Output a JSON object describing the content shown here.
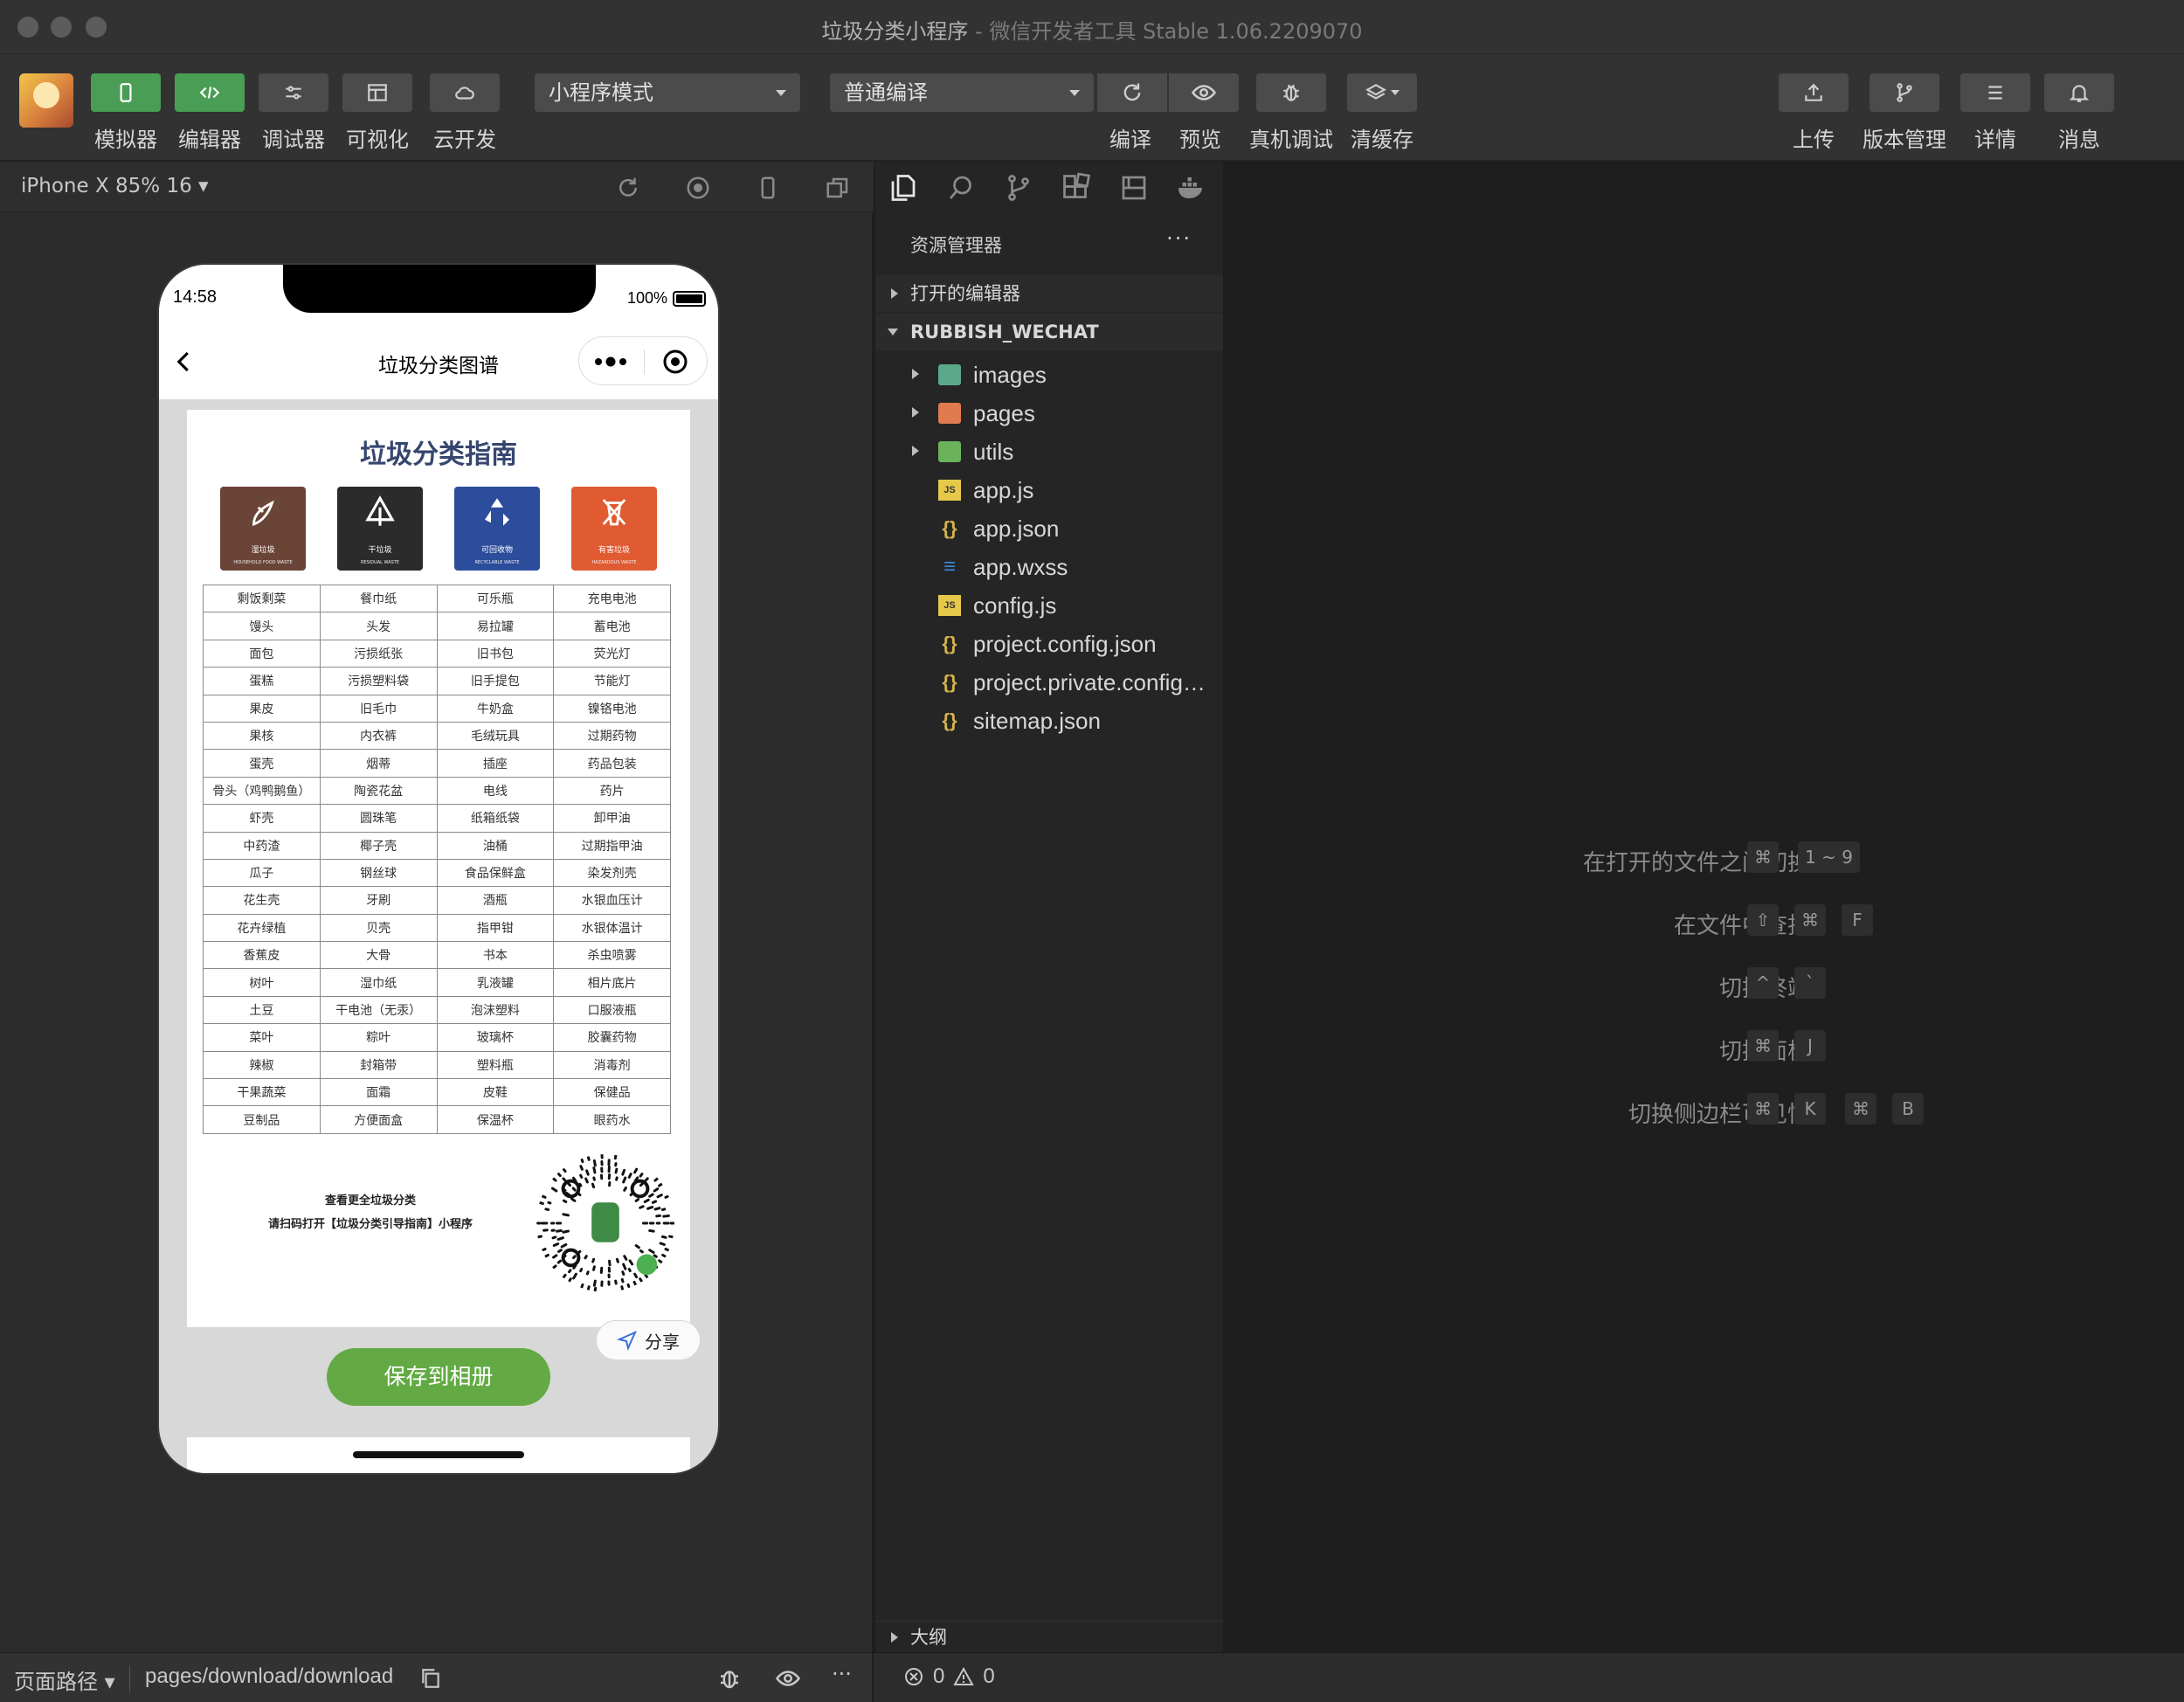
{
  "window": {
    "title_main": "垃圾分类小程序",
    "title_sep": " - ",
    "title_app": "微信开发者工具 Stable 1.06.2209070"
  },
  "toolbar": {
    "left_buttons": [
      {
        "label": "模拟器",
        "icon": "phone-icon",
        "active": true
      },
      {
        "label": "编辑器",
        "icon": "code-icon",
        "active": true
      },
      {
        "label": "调试器",
        "icon": "debug-sliders-icon",
        "active": false
      },
      {
        "label": "可视化",
        "icon": "layout-icon",
        "active": false
      },
      {
        "label": "云开发",
        "icon": "cloud-icon",
        "active": false
      }
    ],
    "mode_select": "小程序模式",
    "compile_select": "普通编译",
    "mid_labels": {
      "compile": "编译",
      "preview": "预览",
      "real_debug": "真机调试",
      "clear_cache": "清缓存"
    },
    "right_buttons": [
      {
        "label": "上传",
        "icon": "upload-icon"
      },
      {
        "label": "版本管理",
        "icon": "branch-icon"
      },
      {
        "label": "详情",
        "icon": "menu-icon"
      },
      {
        "label": "消息",
        "icon": "bell-icon"
      }
    ],
    "accent_color": "#4a9d55"
  },
  "simulator": {
    "device": "iPhone X 85% 16 ▾",
    "status_time": "14:58",
    "battery": "100%",
    "nav_title": "垃圾分类图谱",
    "poster": {
      "title": "垃圾分类指南",
      "bins": [
        {
          "cn": "湿垃圾",
          "en": "HOUSEHOLD FOOD WASTE",
          "color": "#6b4438"
        },
        {
          "cn": "干垃圾",
          "en": "RESIDUAL WASTE",
          "color": "#2b2b2b"
        },
        {
          "cn": "可回收物",
          "en": "RECYCLABLE WASTE",
          "color": "#2c4c9c"
        },
        {
          "cn": "有害垃圾",
          "en": "HAZARDOUS WASTE",
          "color": "#e05a32"
        }
      ],
      "rows": [
        [
          "剩饭剩菜",
          "餐巾纸",
          "可乐瓶",
          "充电电池"
        ],
        [
          "馒头",
          "头发",
          "易拉罐",
          "蓄电池"
        ],
        [
          "面包",
          "污损纸张",
          "旧书包",
          "荧光灯"
        ],
        [
          "蛋糕",
          "污损塑料袋",
          "旧手提包",
          "节能灯"
        ],
        [
          "果皮",
          "旧毛巾",
          "牛奶盒",
          "镍铬电池"
        ],
        [
          "果核",
          "内衣裤",
          "毛绒玩具",
          "过期药物"
        ],
        [
          "蛋壳",
          "烟蒂",
          "插座",
          "药品包装"
        ],
        [
          "骨头（鸡鸭鹅鱼）",
          "陶瓷花盆",
          "电线",
          "药片"
        ],
        [
          "虾壳",
          "圆珠笔",
          "纸箱纸袋",
          "卸甲油"
        ],
        [
          "中药渣",
          "椰子壳",
          "油桶",
          "过期指甲油"
        ],
        [
          "瓜子",
          "钢丝球",
          "食品保鲜盒",
          "染发剂壳"
        ],
        [
          "花生壳",
          "牙刷",
          "酒瓶",
          "水银血压计"
        ],
        [
          "花卉绿植",
          "贝壳",
          "指甲钳",
          "水银体温计"
        ],
        [
          "香蕉皮",
          "大骨",
          "书本",
          "杀虫喷雾"
        ],
        [
          "树叶",
          "湿巾纸",
          "乳液罐",
          "相片底片"
        ],
        [
          "土豆",
          "干电池（无汞）",
          "泡沫塑料",
          "口服液瓶"
        ],
        [
          "菜叶",
          "粽叶",
          "玻璃杯",
          "胶囊药物"
        ],
        [
          "辣椒",
          "封箱带",
          "塑料瓶",
          "消毒剂"
        ],
        [
          "干果蔬菜",
          "面霜",
          "皮鞋",
          "保健品"
        ],
        [
          "豆制品",
          "方便面盒",
          "保温杯",
          "眼药水"
        ]
      ],
      "qr_line1": "查看更全垃圾分类",
      "qr_line2": "请扫码打开【垃圾分类引导指南】小程序"
    },
    "share_label": "分享",
    "save_label": "保存到相册"
  },
  "explorer": {
    "header": "资源管理器",
    "more": "···",
    "open_editors": "打开的编辑器",
    "project": "RUBBISH_WECHAT",
    "files": [
      {
        "name": "images",
        "type": "folder",
        "icon": "images-folder-icon"
      },
      {
        "name": "pages",
        "type": "folder",
        "icon": "pages-folder-icon"
      },
      {
        "name": "utils",
        "type": "folder",
        "icon": "utils-folder-icon"
      },
      {
        "name": "app.js",
        "type": "js",
        "icon": "js-file-icon"
      },
      {
        "name": "app.json",
        "type": "json",
        "icon": "json-file-icon"
      },
      {
        "name": "app.wxss",
        "type": "css",
        "icon": "wxss-file-icon"
      },
      {
        "name": "config.js",
        "type": "js",
        "icon": "js-file-icon"
      },
      {
        "name": "project.config.json",
        "type": "json",
        "icon": "json-file-icon"
      },
      {
        "name": "project.private.config…",
        "type": "json",
        "icon": "json-file-icon"
      },
      {
        "name": "sitemap.json",
        "type": "json",
        "icon": "json-file-icon"
      }
    ],
    "outline": "大纲"
  },
  "editor_hints": [
    {
      "label": "在打开的文件之间切换",
      "keys": [
        "⌘",
        "1 ~ 9"
      ]
    },
    {
      "label": "在文件中查找",
      "keys": [
        "⇧",
        "⌘",
        "F"
      ]
    },
    {
      "label": "切换终端",
      "keys": [
        "^",
        "`"
      ]
    },
    {
      "label": "切换面板",
      "keys": [
        "⌘",
        "J"
      ]
    },
    {
      "label": "切换侧边栏可见性",
      "keys": [
        "⌘",
        "K",
        "⌘",
        "B"
      ]
    }
  ],
  "statusbar": {
    "path_label": "页面路径 ▾",
    "path": "pages/download/download",
    "errors": "0",
    "warnings": "0"
  }
}
